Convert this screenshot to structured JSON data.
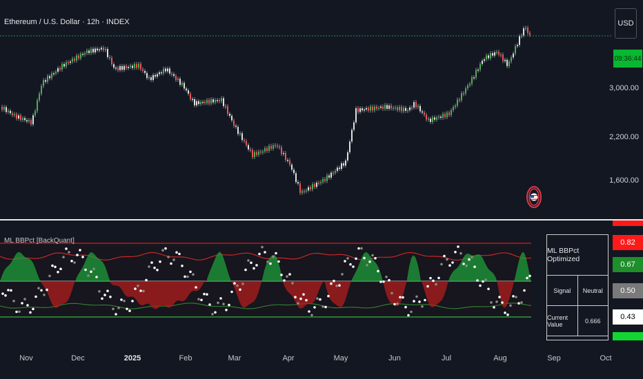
{
  "header": {
    "title": "Ethereum / U.S. Dollar · 12h · INDEX"
  },
  "currency_button": {
    "label": "USD"
  },
  "countdown": {
    "label": "09:36:44"
  },
  "price_axis": {
    "labels": [
      "3,000.00",
      "2,200.00",
      "1,600.00"
    ]
  },
  "x_axis": {
    "labels": [
      "Nov",
      "Dec",
      "2025",
      "Feb",
      "Mar",
      "Apr",
      "May",
      "Jun",
      "Jul",
      "Aug",
      "Sep",
      "Oct"
    ]
  },
  "indicator": {
    "title": "ML BBPct [BackQuant]",
    "levels": [
      {
        "label": "0.82",
        "bg": "#ff1a1a",
        "fg": "#ffffff"
      },
      {
        "label": "0.67",
        "bg": "#1e8f2a",
        "fg": "#ffffff"
      },
      {
        "label": "0.50",
        "bg": "#7a7a7a",
        "fg": "#ffffff"
      },
      {
        "label": "0.43",
        "bg": "#ffffff",
        "fg": "#000000"
      }
    ]
  },
  "table": {
    "title": "ML BBPct Optimized",
    "rows": [
      {
        "label": "Signal",
        "value": "Neutral"
      },
      {
        "label": "Current Value",
        "value": "0.666"
      }
    ]
  },
  "colors": {
    "up": "#26a69a",
    "up_bright": "#4caf50",
    "down": "#ef5350",
    "background": "#131722",
    "accent_green": "#00e676"
  }
}
